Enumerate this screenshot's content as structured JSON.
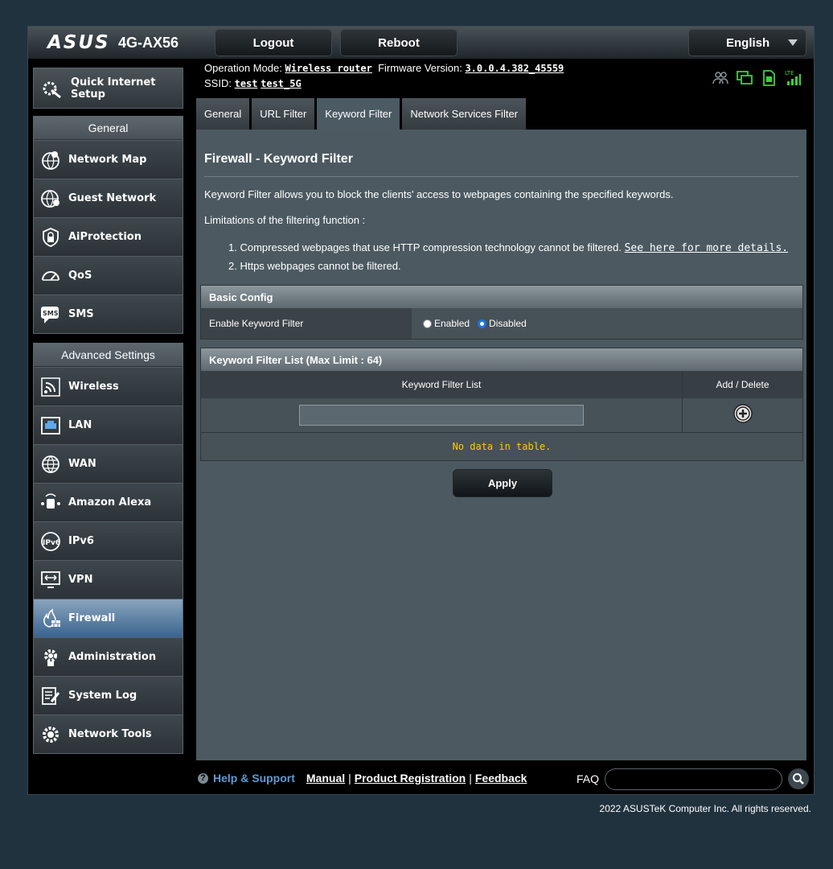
{
  "header": {
    "brand": "ASUS",
    "model": "4G-AX56",
    "logout_label": "Logout",
    "reboot_label": "Reboot",
    "language": "English"
  },
  "info": {
    "op_mode_label": "Operation Mode:",
    "op_mode_value": "Wireless router",
    "fw_label": "Firmware Version:",
    "fw_value": "3.0.0.4.382_45559",
    "ssid_label": "SSID:",
    "ssid_1": "test",
    "ssid_2": "test_5G"
  },
  "sidebar": {
    "qis_label_1": "Quick Internet",
    "qis_label_2": "Setup",
    "general_title": "General",
    "general_items": [
      "Network Map",
      "Guest Network",
      "AiProtection",
      "QoS",
      "SMS"
    ],
    "advanced_title": "Advanced Settings",
    "advanced_items": [
      "Wireless",
      "LAN",
      "WAN",
      "Amazon Alexa",
      "IPv6",
      "VPN",
      "Firewall",
      "Administration",
      "System Log",
      "Network Tools"
    ],
    "active_item": "Firewall"
  },
  "tabs": [
    "General",
    "URL Filter",
    "Keyword Filter",
    "Network Services Filter"
  ],
  "active_tab": "Keyword Filter",
  "main": {
    "title": "Firewall - Keyword Filter",
    "desc": "Keyword Filter allows you to block the clients' access to webpages containing the specified keywords.",
    "limitations": "Limitations of the filtering function :",
    "item1": "1. Compressed webpages that use HTTP compression technology cannot be filtered.",
    "item1_link": "See here for more details.",
    "item2": "2. Https webpages cannot be filtered.",
    "basic_config": "Basic Config",
    "enable_label": "Enable Keyword Filter",
    "enabled": "Enabled",
    "disabled": "Disabled",
    "list_header": "Keyword Filter List (Max Limit : 64)",
    "col_list": "Keyword Filter List",
    "col_add": "Add / Delete",
    "no_data": "No data in table.",
    "apply": "Apply"
  },
  "footer": {
    "help": "Help & Support",
    "manual": "Manual",
    "product_reg": "Product Registration",
    "feedback": "Feedback",
    "faq": "FAQ",
    "copyright": "2022 ASUSTeK Computer Inc. All rights reserved."
  }
}
